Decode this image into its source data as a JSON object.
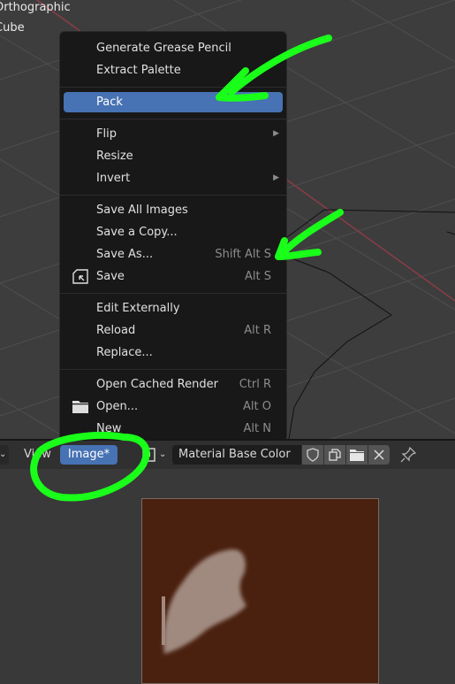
{
  "viewport": {
    "labels": [
      "Orthographic",
      "Cube"
    ]
  },
  "menu": {
    "items": [
      {
        "label": "Generate Grease Pencil",
        "shortcut": ""
      },
      {
        "label": "Extract Palette",
        "shortcut": ""
      },
      {
        "label": "Pack",
        "shortcut": "",
        "active": true
      },
      {
        "label": "Flip",
        "shortcut": "",
        "submenu": true
      },
      {
        "label": "Resize",
        "shortcut": ""
      },
      {
        "label": "Invert",
        "shortcut": "",
        "submenu": true
      },
      {
        "label": "Save All Images",
        "shortcut": ""
      },
      {
        "label": "Save a Copy...",
        "shortcut": ""
      },
      {
        "label": "Save As...",
        "shortcut": "Shift Alt S"
      },
      {
        "label": "Save",
        "shortcut": "Alt S",
        "icon": "save-icon"
      },
      {
        "label": "Edit Externally",
        "shortcut": ""
      },
      {
        "label": "Reload",
        "shortcut": "Alt R"
      },
      {
        "label": "Replace...",
        "shortcut": ""
      },
      {
        "label": "Open Cached Render",
        "shortcut": "Ctrl R"
      },
      {
        "label": "Open...",
        "shortcut": "Alt O",
        "icon": "folder-icon"
      },
      {
        "label": "New",
        "shortcut": "Alt N"
      }
    ],
    "submenu_arrow": "▶"
  },
  "header": {
    "view_label": "View",
    "image_label": "Image*",
    "image_name": "Material Base Color",
    "icons": [
      "shield-icon",
      "duplicate-icon",
      "folder-icon",
      "close-icon",
      "pin-icon"
    ]
  },
  "colors": {
    "accent": "#4772b3",
    "annotation": "#1aff1a",
    "image_background": "#4a200f",
    "stroke": "#a08a80"
  }
}
